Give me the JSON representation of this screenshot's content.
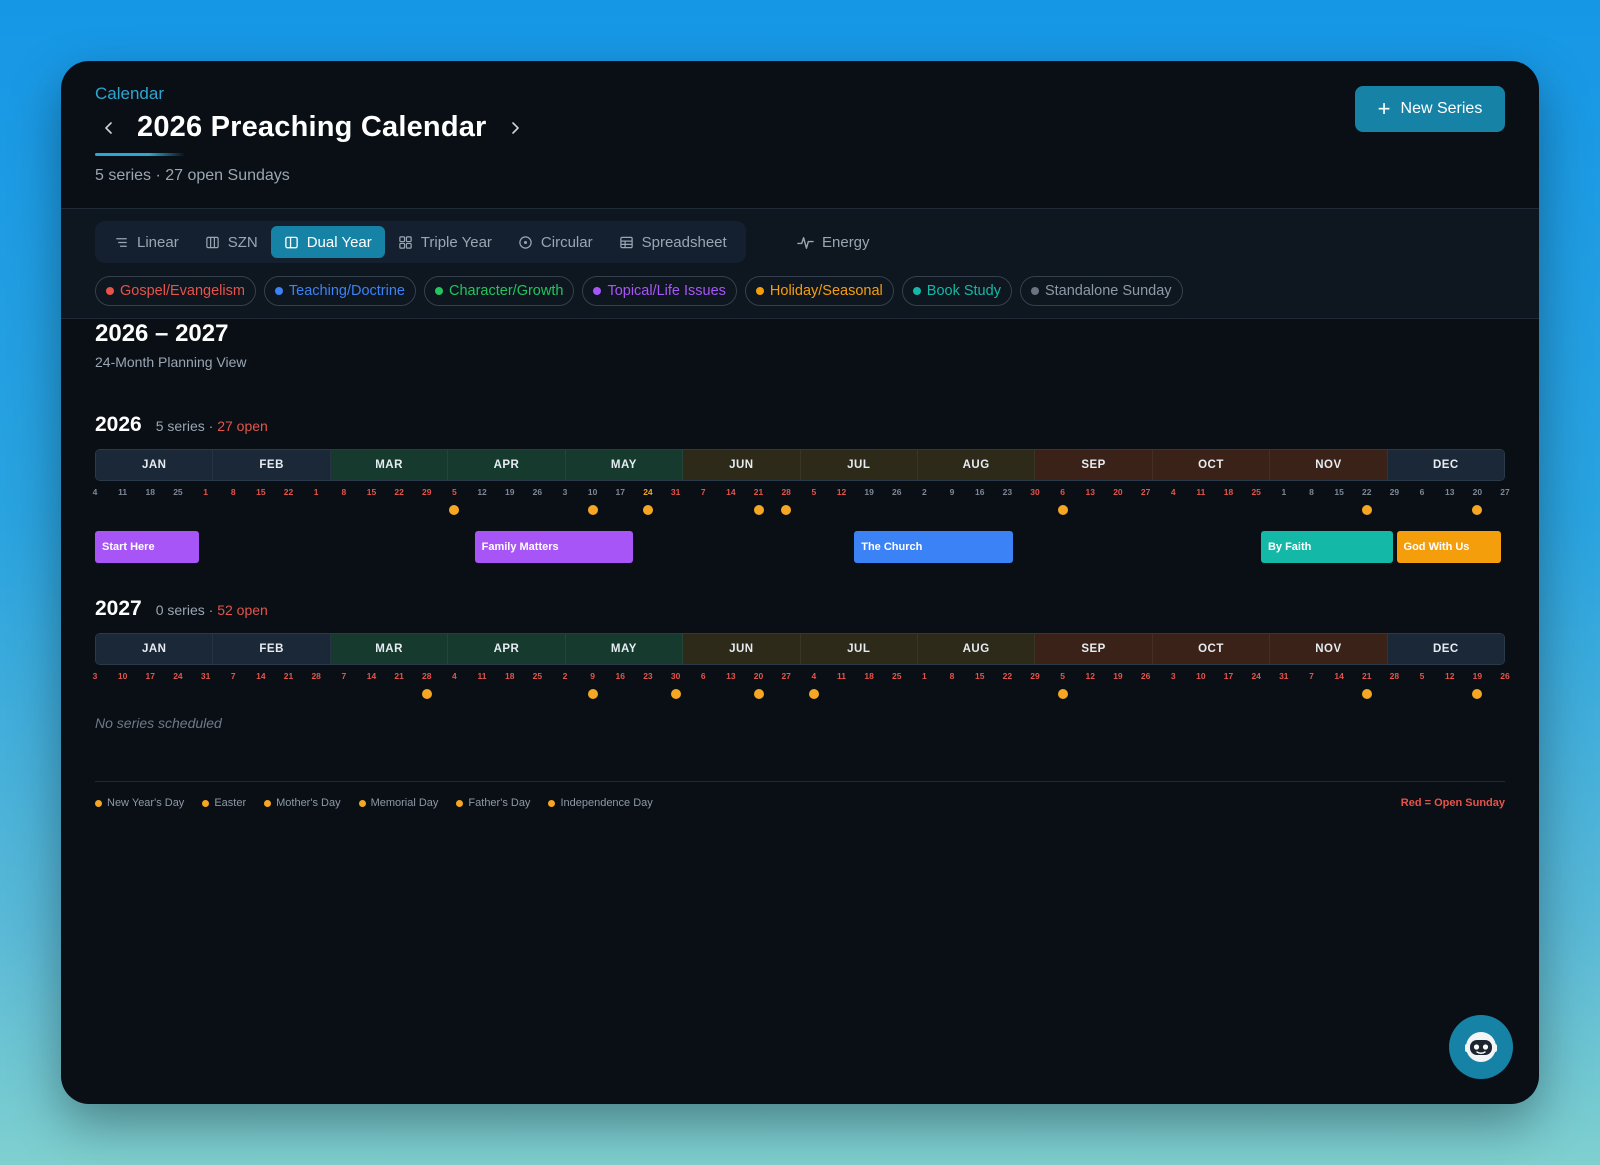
{
  "header": {
    "breadcrumb": "Calendar",
    "title": "2026 Preaching Calendar",
    "subtitle": "5 series · 27 open Sundays",
    "new_series_label": "New Series"
  },
  "views": [
    {
      "label": "Linear",
      "icon": "linear-icon"
    },
    {
      "label": "SZN",
      "icon": "columns-icon"
    },
    {
      "label": "Dual Year",
      "icon": "split-icon",
      "active": true
    },
    {
      "label": "Triple Year",
      "icon": "grid-icon"
    },
    {
      "label": "Circular",
      "icon": "circle-icon"
    },
    {
      "label": "Spreadsheet",
      "icon": "table-icon"
    }
  ],
  "energy_label": "Energy",
  "filters": [
    {
      "label": "Gospel/Evangelism",
      "color": "#e5534b"
    },
    {
      "label": "Teaching/Doctrine",
      "color": "#3b82f6"
    },
    {
      "label": "Character/Growth",
      "color": "#22c55e"
    },
    {
      "label": "Topical/Life Issues",
      "color": "#a855f7"
    },
    {
      "label": "Holiday/Seasonal",
      "color": "#f59e0b"
    },
    {
      "label": "Book Study",
      "color": "#14b8a6"
    },
    {
      "label": "Standalone Sunday",
      "color": "#6b7280"
    }
  ],
  "range": {
    "title": "2026 – 2027",
    "subtitle": "24-Month Planning View"
  },
  "months": [
    "JAN",
    "FEB",
    "MAR",
    "APR",
    "MAY",
    "JUN",
    "JUL",
    "AUG",
    "SEP",
    "OCT",
    "NOV",
    "DEC"
  ],
  "month_colors": [
    "#1b2838",
    "#1b2838",
    "#163a2e",
    "#163a2e",
    "#163a2e",
    "#2e2a1a",
    "#2e2a1a",
    "#2e2a1a",
    "#3a2218",
    "#3a2218",
    "#3a2218",
    "#1b2838"
  ],
  "years": [
    {
      "year": "2026",
      "series_count": "5 series",
      "sep": " · ",
      "open_label": "27 open",
      "sundays": [
        {
          "d": "4",
          "s": "n"
        },
        {
          "d": "11",
          "s": "n"
        },
        {
          "d": "18",
          "s": "n"
        },
        {
          "d": "25",
          "s": "n"
        },
        {
          "d": "1",
          "s": "o"
        },
        {
          "d": "8",
          "s": "o"
        },
        {
          "d": "15",
          "s": "o"
        },
        {
          "d": "22",
          "s": "o"
        },
        {
          "d": "1",
          "s": "o"
        },
        {
          "d": "8",
          "s": "o"
        },
        {
          "d": "15",
          "s": "o"
        },
        {
          "d": "22",
          "s": "o"
        },
        {
          "d": "29",
          "s": "o"
        },
        {
          "d": "5",
          "s": "o"
        },
        {
          "d": "12",
          "s": "n"
        },
        {
          "d": "19",
          "s": "n"
        },
        {
          "d": "26",
          "s": "n"
        },
        {
          "d": "3",
          "s": "n"
        },
        {
          "d": "10",
          "s": "n"
        },
        {
          "d": "17",
          "s": "n"
        },
        {
          "d": "24",
          "s": "h"
        },
        {
          "d": "31",
          "s": "o"
        },
        {
          "d": "7",
          "s": "o"
        },
        {
          "d": "14",
          "s": "o"
        },
        {
          "d": "21",
          "s": "o"
        },
        {
          "d": "28",
          "s": "o"
        },
        {
          "d": "5",
          "s": "o"
        },
        {
          "d": "12",
          "s": "o"
        },
        {
          "d": "19",
          "s": "n"
        },
        {
          "d": "26",
          "s": "n"
        },
        {
          "d": "2",
          "s": "n"
        },
        {
          "d": "9",
          "s": "n"
        },
        {
          "d": "16",
          "s": "n"
        },
        {
          "d": "23",
          "s": "n"
        },
        {
          "d": "30",
          "s": "o"
        },
        {
          "d": "6",
          "s": "o"
        },
        {
          "d": "13",
          "s": "o"
        },
        {
          "d": "20",
          "s": "o"
        },
        {
          "d": "27",
          "s": "o"
        },
        {
          "d": "4",
          "s": "o"
        },
        {
          "d": "11",
          "s": "o"
        },
        {
          "d": "18",
          "s": "o"
        },
        {
          "d": "25",
          "s": "o"
        },
        {
          "d": "1",
          "s": "n"
        },
        {
          "d": "8",
          "s": "n"
        },
        {
          "d": "15",
          "s": "n"
        },
        {
          "d": "22",
          "s": "n"
        },
        {
          "d": "29",
          "s": "n"
        },
        {
          "d": "6",
          "s": "n"
        },
        {
          "d": "13",
          "s": "n"
        },
        {
          "d": "20",
          "s": "n"
        },
        {
          "d": "27",
          "s": "n"
        }
      ],
      "holiday_weeks": [
        13,
        18,
        20,
        24,
        25,
        35,
        46,
        50
      ],
      "series": [
        {
          "name": "Start Here",
          "color": "#a855f7",
          "start": 0,
          "weeks": 4
        },
        {
          "name": "Family Matters",
          "color": "#a855f7",
          "start": 14,
          "weeks": 6
        },
        {
          "name": "The Church",
          "color": "#3b82f6",
          "start": 28,
          "weeks": 6
        },
        {
          "name": "By Faith",
          "color": "#14b8a6",
          "start": 43,
          "weeks": 5
        },
        {
          "name": "God With Us",
          "color": "#f59e0b",
          "start": 48,
          "weeks": 4
        }
      ],
      "empty_note": ""
    },
    {
      "year": "2027",
      "series_count": "0 series",
      "sep": " · ",
      "open_label": "52 open",
      "sundays": [
        {
          "d": "3",
          "s": "o"
        },
        {
          "d": "10",
          "s": "o"
        },
        {
          "d": "17",
          "s": "o"
        },
        {
          "d": "24",
          "s": "o"
        },
        {
          "d": "31",
          "s": "o"
        },
        {
          "d": "7",
          "s": "o"
        },
        {
          "d": "14",
          "s": "o"
        },
        {
          "d": "21",
          "s": "o"
        },
        {
          "d": "28",
          "s": "o"
        },
        {
          "d": "7",
          "s": "o"
        },
        {
          "d": "14",
          "s": "o"
        },
        {
          "d": "21",
          "s": "o"
        },
        {
          "d": "28",
          "s": "o"
        },
        {
          "d": "4",
          "s": "o"
        },
        {
          "d": "11",
          "s": "o"
        },
        {
          "d": "18",
          "s": "o"
        },
        {
          "d": "25",
          "s": "o"
        },
        {
          "d": "2",
          "s": "o"
        },
        {
          "d": "9",
          "s": "o"
        },
        {
          "d": "16",
          "s": "o"
        },
        {
          "d": "23",
          "s": "o"
        },
        {
          "d": "30",
          "s": "o"
        },
        {
          "d": "6",
          "s": "o"
        },
        {
          "d": "13",
          "s": "o"
        },
        {
          "d": "20",
          "s": "o"
        },
        {
          "d": "27",
          "s": "o"
        },
        {
          "d": "4",
          "s": "o"
        },
        {
          "d": "11",
          "s": "o"
        },
        {
          "d": "18",
          "s": "o"
        },
        {
          "d": "25",
          "s": "o"
        },
        {
          "d": "1",
          "s": "o"
        },
        {
          "d": "8",
          "s": "o"
        },
        {
          "d": "15",
          "s": "o"
        },
        {
          "d": "22",
          "s": "o"
        },
        {
          "d": "29",
          "s": "o"
        },
        {
          "d": "5",
          "s": "o"
        },
        {
          "d": "12",
          "s": "o"
        },
        {
          "d": "19",
          "s": "o"
        },
        {
          "d": "26",
          "s": "o"
        },
        {
          "d": "3",
          "s": "o"
        },
        {
          "d": "10",
          "s": "o"
        },
        {
          "d": "17",
          "s": "o"
        },
        {
          "d": "24",
          "s": "o"
        },
        {
          "d": "31",
          "s": "o"
        },
        {
          "d": "7",
          "s": "o"
        },
        {
          "d": "14",
          "s": "o"
        },
        {
          "d": "21",
          "s": "o"
        },
        {
          "d": "28",
          "s": "o"
        },
        {
          "d": "5",
          "s": "o"
        },
        {
          "d": "12",
          "s": "o"
        },
        {
          "d": "19",
          "s": "o"
        },
        {
          "d": "26",
          "s": "o"
        }
      ],
      "holiday_weeks": [
        12,
        18,
        21,
        24,
        26,
        35,
        46,
        50
      ],
      "series": [],
      "empty_note": "No series scheduled"
    }
  ],
  "legend": {
    "items": [
      "New Year's Day",
      "Easter",
      "Mother's Day",
      "Memorial Day",
      "Father's Day",
      "Independence Day"
    ],
    "note": "Red = Open Sunday"
  },
  "colors": {
    "open": "#e5534b",
    "holiday": "#f5a623",
    "accent": "#1683a6"
  }
}
